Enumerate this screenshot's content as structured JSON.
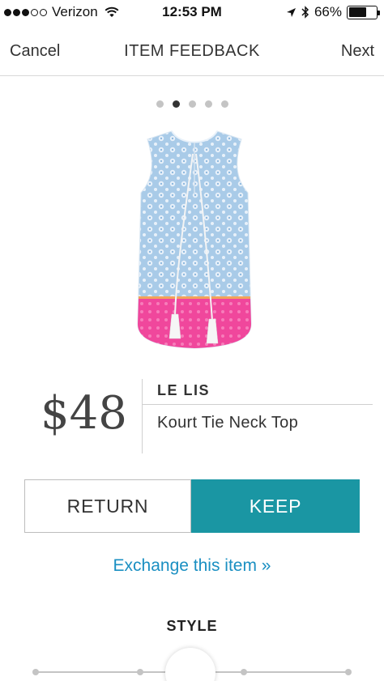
{
  "status_bar": {
    "carrier": "Verizon",
    "time": "12:53 PM",
    "battery": "66%",
    "battery_level": 0.66,
    "signal_bars_filled": 3,
    "signal_bars_total": 5
  },
  "nav": {
    "cancel_label": "Cancel",
    "title": "ITEM FEEDBACK",
    "next_label": "Next"
  },
  "pager": {
    "total": 5,
    "active_index": 1
  },
  "product": {
    "price": "$48",
    "brand": "LE LIS",
    "name": "Kourt Tie Neck Top"
  },
  "actions": {
    "return_label": "RETURN",
    "keep_label": "KEEP",
    "exchange_label": "Exchange this item »"
  },
  "section": {
    "style_label": "STYLE"
  },
  "colors": {
    "accent": "#1a96a3",
    "link": "#1a8fc2",
    "top_print_blue": "#a9cbe8",
    "top_border_pink": "#f0479c"
  },
  "icons": {
    "wifi": "wifi-icon",
    "location": "location-arrow-icon",
    "bluetooth": "bluetooth-icon",
    "battery": "battery-icon"
  }
}
